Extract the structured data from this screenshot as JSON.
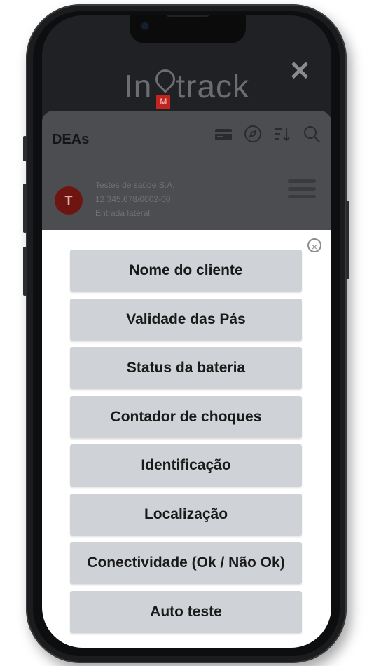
{
  "app": {
    "logo_left": "In",
    "logo_mark": "M",
    "logo_right": "track",
    "close_symbol": "✕"
  },
  "sheet": {
    "title": "DEAs",
    "icons": [
      "card-icon",
      "compass-icon",
      "sort-icon",
      "search-icon"
    ],
    "item": {
      "avatar_letter": "T",
      "line1": "Testes de saúde S.A.",
      "line2": "12.345.678/0002-00",
      "line3": "Entrada lateral"
    }
  },
  "modal": {
    "close_symbol": "×",
    "options": [
      "Nome do cliente",
      "Validade das Pás",
      "Status da bateria",
      "Contador de choques",
      "Identificação",
      "Localização",
      "Conectividade (Ok / Não Ok)",
      "Auto teste"
    ]
  },
  "colors": {
    "accent_red": "#c0261f",
    "button_gray": "#cfd2d7",
    "screen_dark": "#202124"
  }
}
